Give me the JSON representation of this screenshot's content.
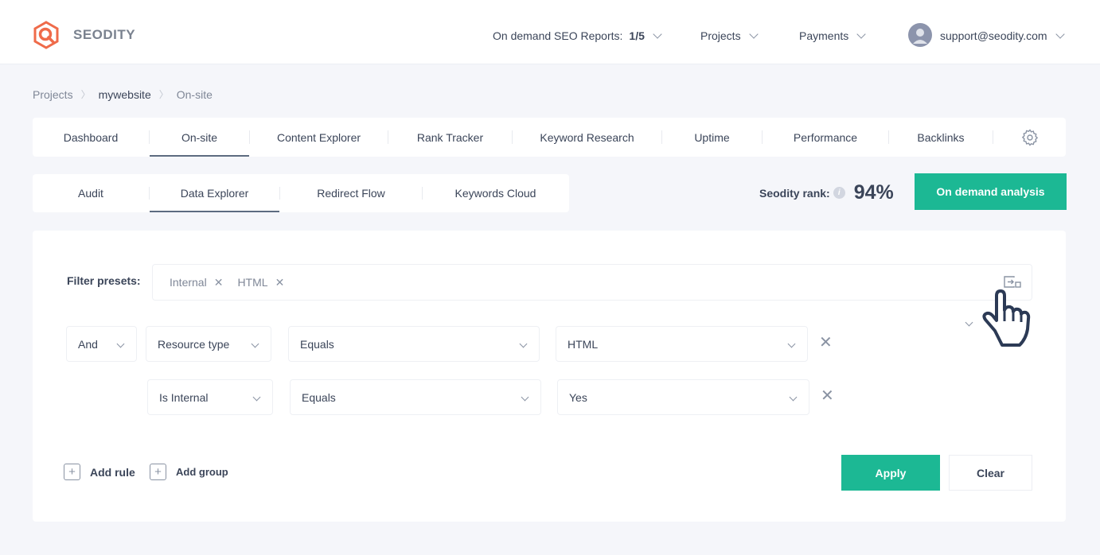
{
  "brand": {
    "name": "SEODITY",
    "accent": "#1cb894",
    "logo_color": "#ef6b4a"
  },
  "header": {
    "reports_label": "On demand SEO Reports:",
    "reports_value": "1/5",
    "projects_label": "Projects",
    "payments_label": "Payments",
    "user_email": "support@seodity.com"
  },
  "breadcrumb": [
    "Projects",
    "mywebsite",
    "On-site"
  ],
  "main_tabs": [
    {
      "label": "Dashboard",
      "active": false
    },
    {
      "label": "On-site",
      "active": true
    },
    {
      "label": "Content Explorer",
      "active": false
    },
    {
      "label": "Rank Tracker",
      "active": false
    },
    {
      "label": "Keyword Research",
      "active": false
    },
    {
      "label": "Uptime",
      "active": false
    },
    {
      "label": "Performance",
      "active": false
    },
    {
      "label": "Backlinks",
      "active": false
    }
  ],
  "sub_tabs": [
    {
      "label": "Audit",
      "active": false
    },
    {
      "label": "Data Explorer",
      "active": true
    },
    {
      "label": "Redirect Flow",
      "active": false
    },
    {
      "label": "Keywords Cloud",
      "active": false
    }
  ],
  "rank": {
    "label": "Seodity rank:",
    "value": "94%"
  },
  "on_demand_button": "On demand analysis",
  "filters": {
    "presets_label": "Filter presets:",
    "presets": [
      "Internal",
      "HTML"
    ],
    "group_operator": "And",
    "rules": [
      {
        "field": "Resource type",
        "operator": "Equals",
        "value": "HTML"
      },
      {
        "field": "Is Internal",
        "operator": "Equals",
        "value": "Yes"
      }
    ],
    "add_rule": "Add rule",
    "add_group": "Add group",
    "apply": "Apply",
    "clear": "Clear"
  }
}
